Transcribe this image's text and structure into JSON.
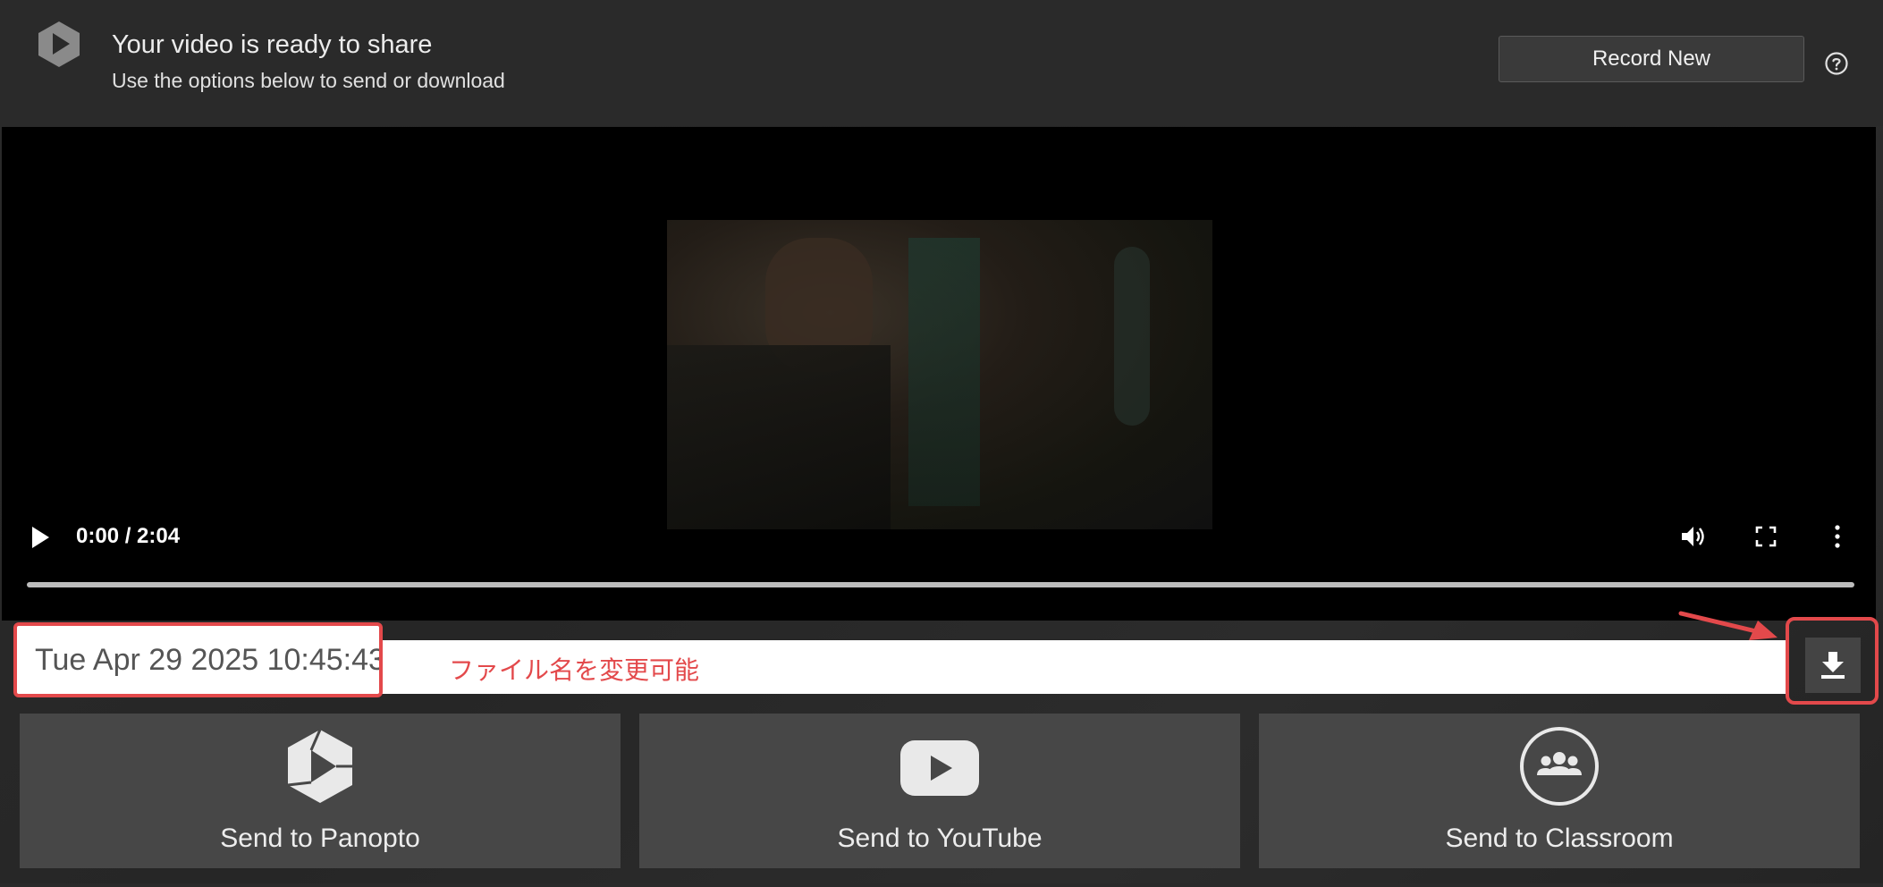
{
  "header": {
    "title": "Your video is ready to share",
    "subtitle": "Use the options below to send or download",
    "record_button_label": "Record New",
    "logo_icon": "panopto-logo-icon",
    "help_icon": "help-circle-icon"
  },
  "player": {
    "time_display": "0:00 / 2:04",
    "progress_fraction": 0,
    "controls": [
      "play-icon",
      "volume-icon",
      "fullscreen-icon",
      "more-vertical-icon"
    ]
  },
  "filename": {
    "value": "Tue Apr 29 2025 10:45:43"
  },
  "annotation": {
    "text": "ファイル名を変更可能",
    "color": "#e3494b"
  },
  "download": {
    "icon": "download-icon"
  },
  "destinations": [
    {
      "label": "Send to Panopto",
      "icon": "panopto-icon"
    },
    {
      "label": "Send to YouTube",
      "icon": "youtube-icon"
    },
    {
      "label": "Send to Classroom",
      "icon": "classroom-icon"
    }
  ],
  "colors": {
    "background": "#2a2a2a",
    "card": "#474747",
    "highlight": "#e3494b"
  }
}
